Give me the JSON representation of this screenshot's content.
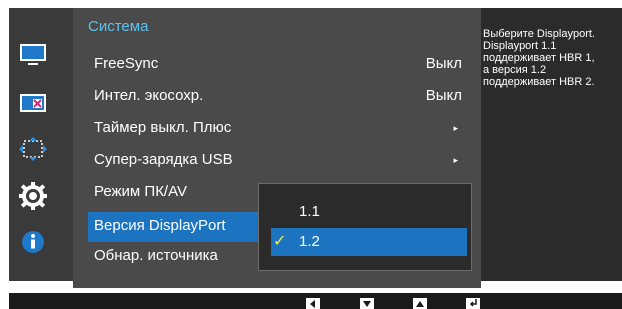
{
  "menu": {
    "title": "Система",
    "items": [
      {
        "label": "FreeSync",
        "value": "Выкл"
      },
      {
        "label": "Интел. экосохр.",
        "value": "Выкл"
      },
      {
        "label": "Таймер выкл. Плюс",
        "arrow": "▸"
      },
      {
        "label": "Супер-зарядка USB",
        "arrow": "▸"
      },
      {
        "label": "Режим ПК/AV"
      },
      {
        "label": "Версия DisplayPort"
      },
      {
        "label": "Обнар. источника"
      }
    ]
  },
  "submenu": {
    "options": [
      {
        "label": "1.1"
      },
      {
        "label": "1.2",
        "check": "✓"
      }
    ]
  },
  "help_text": "Выберите Displayport.\nDisplayport 1.1\nподдерживает HBR 1,\nа версия 1.2\nподдерживает HBR 2.",
  "side_icons": [
    "picture-icon",
    "color-icon",
    "size-position-icon",
    "system-gear-icon",
    "information-icon"
  ],
  "bottom_buttons": [
    "left-arrow-icon",
    "down-arrow-icon",
    "up-arrow-icon",
    "enter-icon"
  ],
  "colors": {
    "accent": "#1c74c1",
    "title": "#5ec3f1",
    "check": "#ffe94a",
    "menu_bg": "#4a4a4a",
    "osd_bg": "#2b2b2b"
  }
}
